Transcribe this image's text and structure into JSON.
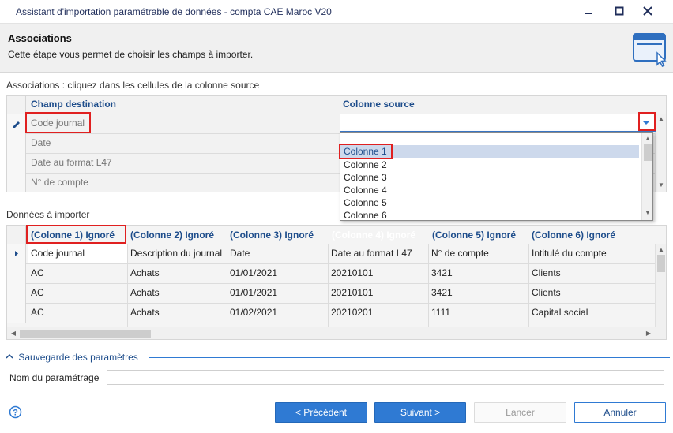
{
  "window": {
    "title": "Assistant d'importation paramétrable de données - compta CAE Maroc V20"
  },
  "header": {
    "title": "Associations",
    "subtitle": "Cette étape vous permet de choisir les champs à importer."
  },
  "associations": {
    "label": "Associations : cliquez dans les cellules de la colonne source",
    "col_dest": "Champ destination",
    "col_source": "Colonne source",
    "rows": [
      "Code journal",
      "Date",
      "Date au format L47",
      "N° de compte"
    ],
    "dropdown_options": [
      "Colonne 1",
      "Colonne 2",
      "Colonne 3",
      "Colonne 4",
      "Colonne 5",
      "Colonne 6"
    ],
    "selected_option": "Colonne 1"
  },
  "data_import": {
    "label": "Données à importer",
    "headers": [
      "(Colonne 1) Ignoré",
      "(Colonne 2) Ignoré",
      "(Colonne 3) Ignoré",
      "(Colonne 4) Ignoré",
      "(Colonne 5) Ignoré",
      "(Colonne 6) Ignoré"
    ],
    "rows": [
      [
        "Code journal",
        "Description du journal",
        "Date",
        "Date au format L47",
        "N° de compte",
        "Intitulé du compte"
      ],
      [
        "AC",
        "Achats",
        "01/01/2021",
        "20210101",
        "3421",
        "Clients"
      ],
      [
        "AC",
        "Achats",
        "01/01/2021",
        "20210101",
        "3421",
        "Clients"
      ],
      [
        "AC",
        "Achats",
        "01/02/2021",
        "20210201",
        "1111",
        "Capital social"
      ]
    ]
  },
  "save_section": {
    "title": "Sauvegarde des paramètres",
    "name_label": "Nom du paramétrage",
    "name_value": ""
  },
  "buttons": {
    "previous": "< Précédent",
    "next": "Suivant >",
    "launch": "Lancer",
    "cancel": "Annuler"
  },
  "colors": {
    "accent": "#2f7ad3",
    "header_text": "#1f4e8c",
    "highlight": "#e02020"
  }
}
